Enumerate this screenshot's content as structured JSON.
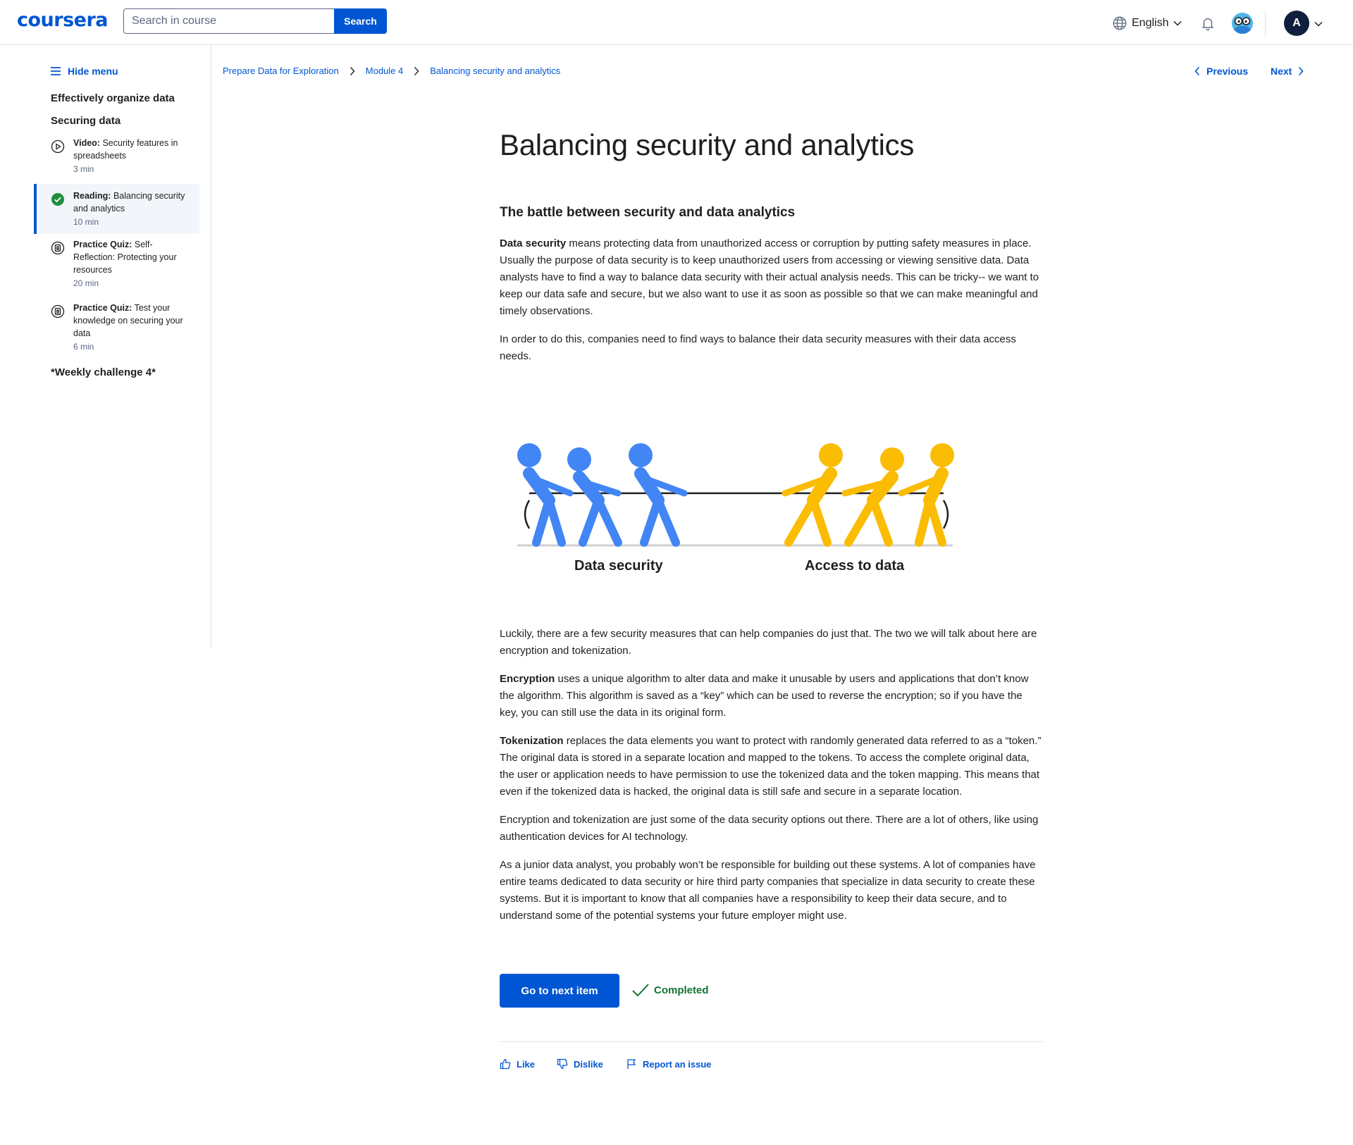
{
  "header": {
    "logo": "coursera",
    "search_placeholder": "Search in course",
    "search_button": "Search",
    "language": "English",
    "avatar_initial": "A"
  },
  "sidebar": {
    "hide_menu": "Hide menu",
    "section1": "Effectively organize data",
    "section2": "Securing data",
    "items": [
      {
        "kind": "Video:",
        "title": "Security features in spreadsheets",
        "duration": "3 min",
        "icon": "play-circle-icon",
        "status": "not-started"
      },
      {
        "kind": "Reading:",
        "title": "Balancing security and analytics",
        "duration": "10 min",
        "icon": "check-circle-icon",
        "status": "completed"
      },
      {
        "kind": "Practice Quiz:",
        "title": "Self-Reflection: Protecting your resources",
        "duration": "20 min",
        "icon": "quiz-icon",
        "status": "not-started"
      },
      {
        "kind": "Practice Quiz:",
        "title": "Test your knowledge on securing your data",
        "duration": "6 min",
        "icon": "quiz-icon",
        "status": "not-started"
      }
    ],
    "section3": "*Weekly challenge 4*"
  },
  "breadcrumb": [
    "Prepare Data for Exploration",
    "Module 4",
    "Balancing security and analytics"
  ],
  "nav": {
    "previous": "Previous",
    "next": "Next"
  },
  "content": {
    "title": "Balancing security and analytics",
    "subtitle": "The battle between security and data analytics",
    "p1_bold": "Data security",
    "p1_rest": " means protecting data from unauthorized access or corruption by putting safety measures in place. Usually the purpose of data security is to keep unauthorized users from accessing or viewing sensitive data. Data analysts have to find a way to balance data security with their actual analysis needs. This can be tricky-- we want to keep our data safe and secure, but we also want to use it as soon as possible so that we can make meaningful and timely observations.",
    "p2": "In order to do this, companies need to find ways to balance their data security measures with their data access needs.",
    "figure": {
      "left_label": "Data security",
      "right_label": "Access to data",
      "left_color": "#4285f4",
      "right_color": "#fbbc04"
    },
    "p3": "Luckily, there are a few security measures that can help companies do just that. The two we will talk about here are encryption and tokenization.",
    "p4_bold": "Encryption",
    "p4_rest": " uses a unique algorithm to alter data and make it unusable by users and applications that don’t know the algorithm. This algorithm is saved as a “key” which can be used to reverse the encryption; so if you have the key, you can still use the data in its original form.",
    "p5_bold": "Tokenization",
    "p5_rest": " replaces the data elements you want to protect with randomly generated data referred to as a “token.” The original data is stored in a separate location and mapped to the tokens. To access the complete original data, the user or application needs to have permission to use the tokenized data and the token mapping. This means that even if the tokenized data is hacked, the original data is still safe and secure in a separate location.",
    "p6": "Encryption and tokenization are just some of the data security options out there. There are a lot of others, like using authentication devices for AI technology.",
    "p7": "As a junior data analyst, you probably won’t be responsible for building out these systems. A lot of companies have entire teams dedicated to data security or hire third party companies that specialize in data security to create these systems. But it is important to know that all companies have a responsibility to keep their data secure, and to understand some of the potential systems your future employer might use."
  },
  "footer": {
    "next_button": "Go to next item",
    "completed": "Completed",
    "like": "Like",
    "dislike": "Dislike",
    "report": "Report an issue"
  },
  "colors": {
    "accent": "#0056d2",
    "completed_green": "#137333"
  }
}
